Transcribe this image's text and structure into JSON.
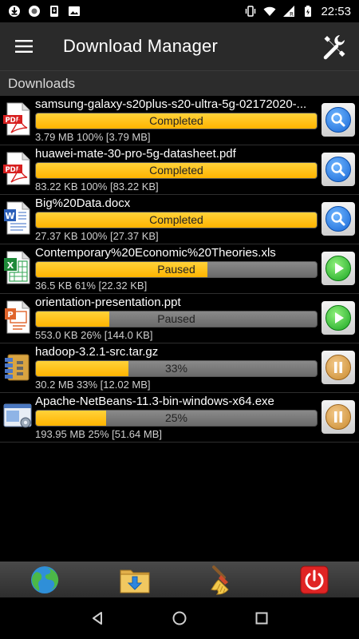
{
  "status_bar": {
    "time": "22:53"
  },
  "app_bar": {
    "title": "Download Manager"
  },
  "section": {
    "title": "Downloads"
  },
  "downloads": [
    {
      "name": "samsung-galaxy-s20plus-s20-ultra-5g-02172020-...",
      "status": "Completed",
      "progress": 100,
      "meta": "3.79 MB  100% [3.79 MB]",
      "type": "pdf",
      "action": "search"
    },
    {
      "name": "huawei-mate-30-pro-5g-datasheet.pdf",
      "status": "Completed",
      "progress": 100,
      "meta": "83.22 KB  100% [83.22 KB]",
      "type": "pdf",
      "action": "search"
    },
    {
      "name": "Big%20Data.docx",
      "status": "Completed",
      "progress": 100,
      "meta": "27.37 KB  100% [27.37 KB]",
      "type": "doc",
      "action": "search"
    },
    {
      "name": "Contemporary%20Economic%20Theories.xls",
      "status": "Paused",
      "progress": 61,
      "meta": "36.5 KB  61% [22.32 KB]",
      "type": "xls",
      "action": "play"
    },
    {
      "name": "orientation-presentation.ppt",
      "status": "Paused",
      "progress": 26,
      "meta": "553.0 KB  26% [144.0 KB]",
      "type": "ppt",
      "action": "play"
    },
    {
      "name": "hadoop-3.2.1-src.tar.gz",
      "status": "33%",
      "progress": 33,
      "meta": "30.2 MB  33% [12.02 MB]",
      "type": "archive",
      "action": "pause"
    },
    {
      "name": "Apache-NetBeans-11.3-bin-windows-x64.exe",
      "status": "25%",
      "progress": 25,
      "meta": "193.95 MB  25% [51.64 MB]",
      "type": "exe",
      "action": "pause"
    }
  ],
  "toolbar": {
    "items": [
      "globe-icon",
      "download-folder-icon",
      "broom-icon",
      "power-icon"
    ]
  },
  "colors": {
    "progress_fill": "#ffc000",
    "app_bar": "#2a2a2a",
    "background": "#000000"
  }
}
